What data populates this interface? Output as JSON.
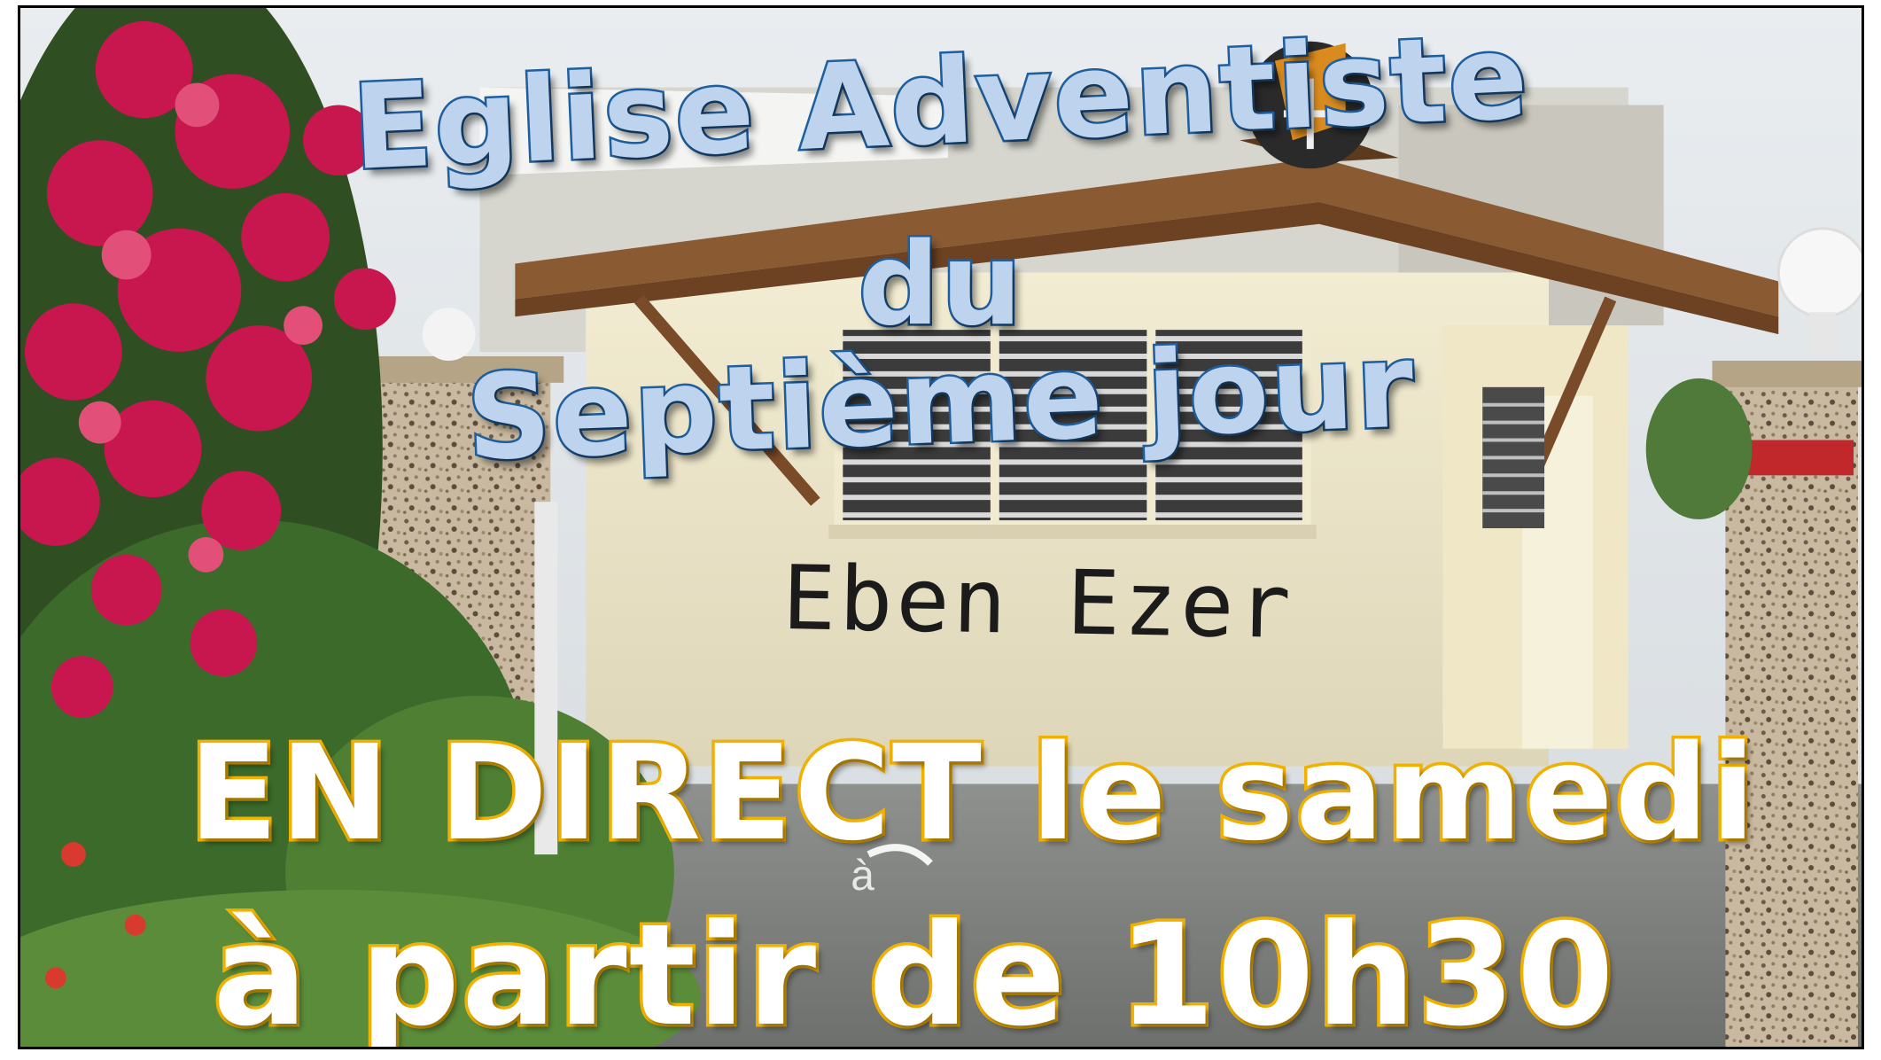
{
  "poster": {
    "title_line1": "Eglise Adventiste",
    "title_line2": "du",
    "title_line3": "Septième jour",
    "building_sign": "Eben Ezer",
    "announce_line1": "EN DIRECT le samedi",
    "announce_line2": "à partir de 10h30"
  },
  "colors": {
    "title_fill": "#bdd3ee",
    "title_outline": "#1f5f9f",
    "announce_fill": "#ffffff",
    "announce_outline": "#f2b000",
    "flowers": "#c8174e"
  }
}
